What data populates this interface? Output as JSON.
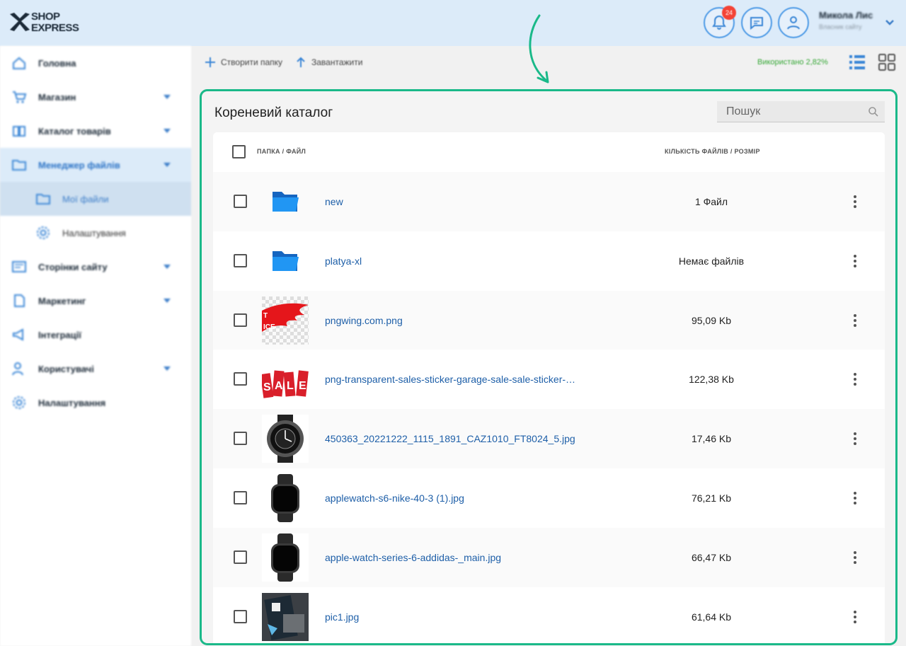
{
  "header": {
    "logo_line1": "SHOP",
    "logo_line2": "EXPRESS",
    "notification_count": "24",
    "user_name": "Микола Лис",
    "user_role": "Власник сайту"
  },
  "sidebar": {
    "items": [
      {
        "label": "Головна",
        "icon": "home-icon",
        "caret": false
      },
      {
        "label": "Магазин",
        "icon": "cart-icon",
        "caret": true
      },
      {
        "label": "Каталог товарів",
        "icon": "book-icon",
        "caret": true
      },
      {
        "label": "Менеджер файлів",
        "icon": "folder-icon",
        "caret": true,
        "active": true
      },
      {
        "label": "Мої файли",
        "icon": "folder-icon",
        "sub": true,
        "active": true
      },
      {
        "label": "Налаштування",
        "icon": "gear-icon",
        "sub": true
      },
      {
        "label": "Сторінки сайту",
        "icon": "pages-icon",
        "caret": true
      },
      {
        "label": "Маркетинг",
        "icon": "marketing-icon",
        "caret": true
      },
      {
        "label": "Інтеграції",
        "icon": "megaphone-icon",
        "caret": false
      },
      {
        "label": "Користувачі",
        "icon": "users-icon",
        "caret": true
      },
      {
        "label": "Налаштування",
        "icon": "gear-icon",
        "caret": false
      }
    ]
  },
  "toolbar": {
    "create_folder": "Створити папку",
    "upload": "Завантажити",
    "usage": "Використано 2,82%"
  },
  "panel": {
    "title": "Кореневий каталог",
    "search_placeholder": "Пошук",
    "col_name": "ПАПКА / ФАЙЛ",
    "col_size": "КІЛЬКІСТЬ ФАЙЛІВ / РОЗМІР"
  },
  "files": [
    {
      "name": "new",
      "size": "1 Файл",
      "thumb": "folder"
    },
    {
      "name": "platya-xl",
      "size": "Немає файлів",
      "thumb": "folder"
    },
    {
      "name": "pngwing.com.png",
      "size": "95,09 Kb",
      "thumb": "flame"
    },
    {
      "name": "png-transparent-sales-sticker-garage-sale-sale-sticker-mi...",
      "size": "122,38 Kb",
      "thumb": "sale"
    },
    {
      "name": "450363_20221222_1115_1891_CAZ1010_FT8024_5.jpg",
      "size": "17,46 Kb",
      "thumb": "watch-round"
    },
    {
      "name": "applewatch-s6-nike-40-3 (1).jpg",
      "size": "76,21 Kb",
      "thumb": "watch-square"
    },
    {
      "name": "apple-watch-series-6-addidas-_main.jpg",
      "size": "66,47 Kb",
      "thumb": "watch-square"
    },
    {
      "name": "pic1.jpg",
      "size": "61,64 Kb",
      "thumb": "photo"
    }
  ],
  "colors": {
    "accent": "#2b73c6",
    "panel_border": "#1ab989",
    "header_bg": "#dcebf9",
    "link": "#1e5fa8"
  }
}
